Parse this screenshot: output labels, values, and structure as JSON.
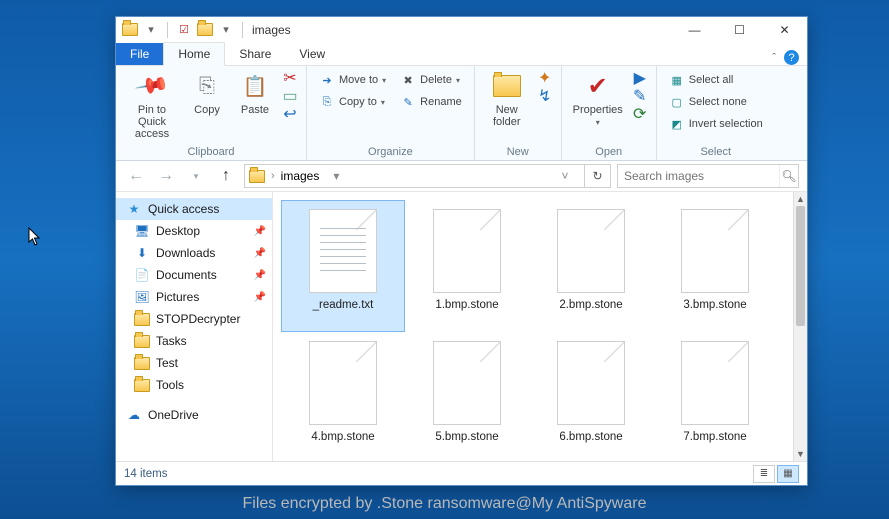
{
  "window": {
    "title": "images"
  },
  "tabs": {
    "file": "File",
    "home": "Home",
    "share": "Share",
    "view": "View"
  },
  "ribbon": {
    "clipboard": {
      "label": "Clipboard",
      "pin": "Pin to Quick access",
      "copy": "Copy",
      "paste": "Paste"
    },
    "organize": {
      "label": "Organize",
      "moveto": "Move to",
      "copyto": "Copy to",
      "delete": "Delete",
      "rename": "Rename"
    },
    "new": {
      "label": "New",
      "newfolder": "New folder"
    },
    "open": {
      "label": "Open",
      "properties": "Properties"
    },
    "select": {
      "label": "Select",
      "all": "Select all",
      "none": "Select none",
      "invert": "Invert selection"
    }
  },
  "address": {
    "segment": "images",
    "dropdown": "›"
  },
  "search": {
    "placeholder": "Search images"
  },
  "navpane": {
    "quick": "Quick access",
    "items": [
      {
        "label": "Desktop",
        "pinned": true
      },
      {
        "label": "Downloads",
        "pinned": true
      },
      {
        "label": "Documents",
        "pinned": true
      },
      {
        "label": "Pictures",
        "pinned": true
      },
      {
        "label": "STOPDecrypter",
        "pinned": false
      },
      {
        "label": "Tasks",
        "pinned": false
      },
      {
        "label": "Test",
        "pinned": false
      },
      {
        "label": "Tools",
        "pinned": false
      }
    ],
    "onedrive": "OneDrive"
  },
  "files": [
    {
      "name": "_readme.txt",
      "type": "txt",
      "selected": true
    },
    {
      "name": "1.bmp.stone",
      "type": "blank"
    },
    {
      "name": "2.bmp.stone",
      "type": "blank"
    },
    {
      "name": "3.bmp.stone",
      "type": "blank"
    },
    {
      "name": "4.bmp.stone",
      "type": "blank"
    },
    {
      "name": "5.bmp.stone",
      "type": "blank"
    },
    {
      "name": "6.bmp.stone",
      "type": "blank"
    },
    {
      "name": "7.bmp.stone",
      "type": "blank"
    }
  ],
  "status": {
    "count": "14 items"
  },
  "caption": "Files encrypted by .Stone ransomware@My AntiSpyware"
}
